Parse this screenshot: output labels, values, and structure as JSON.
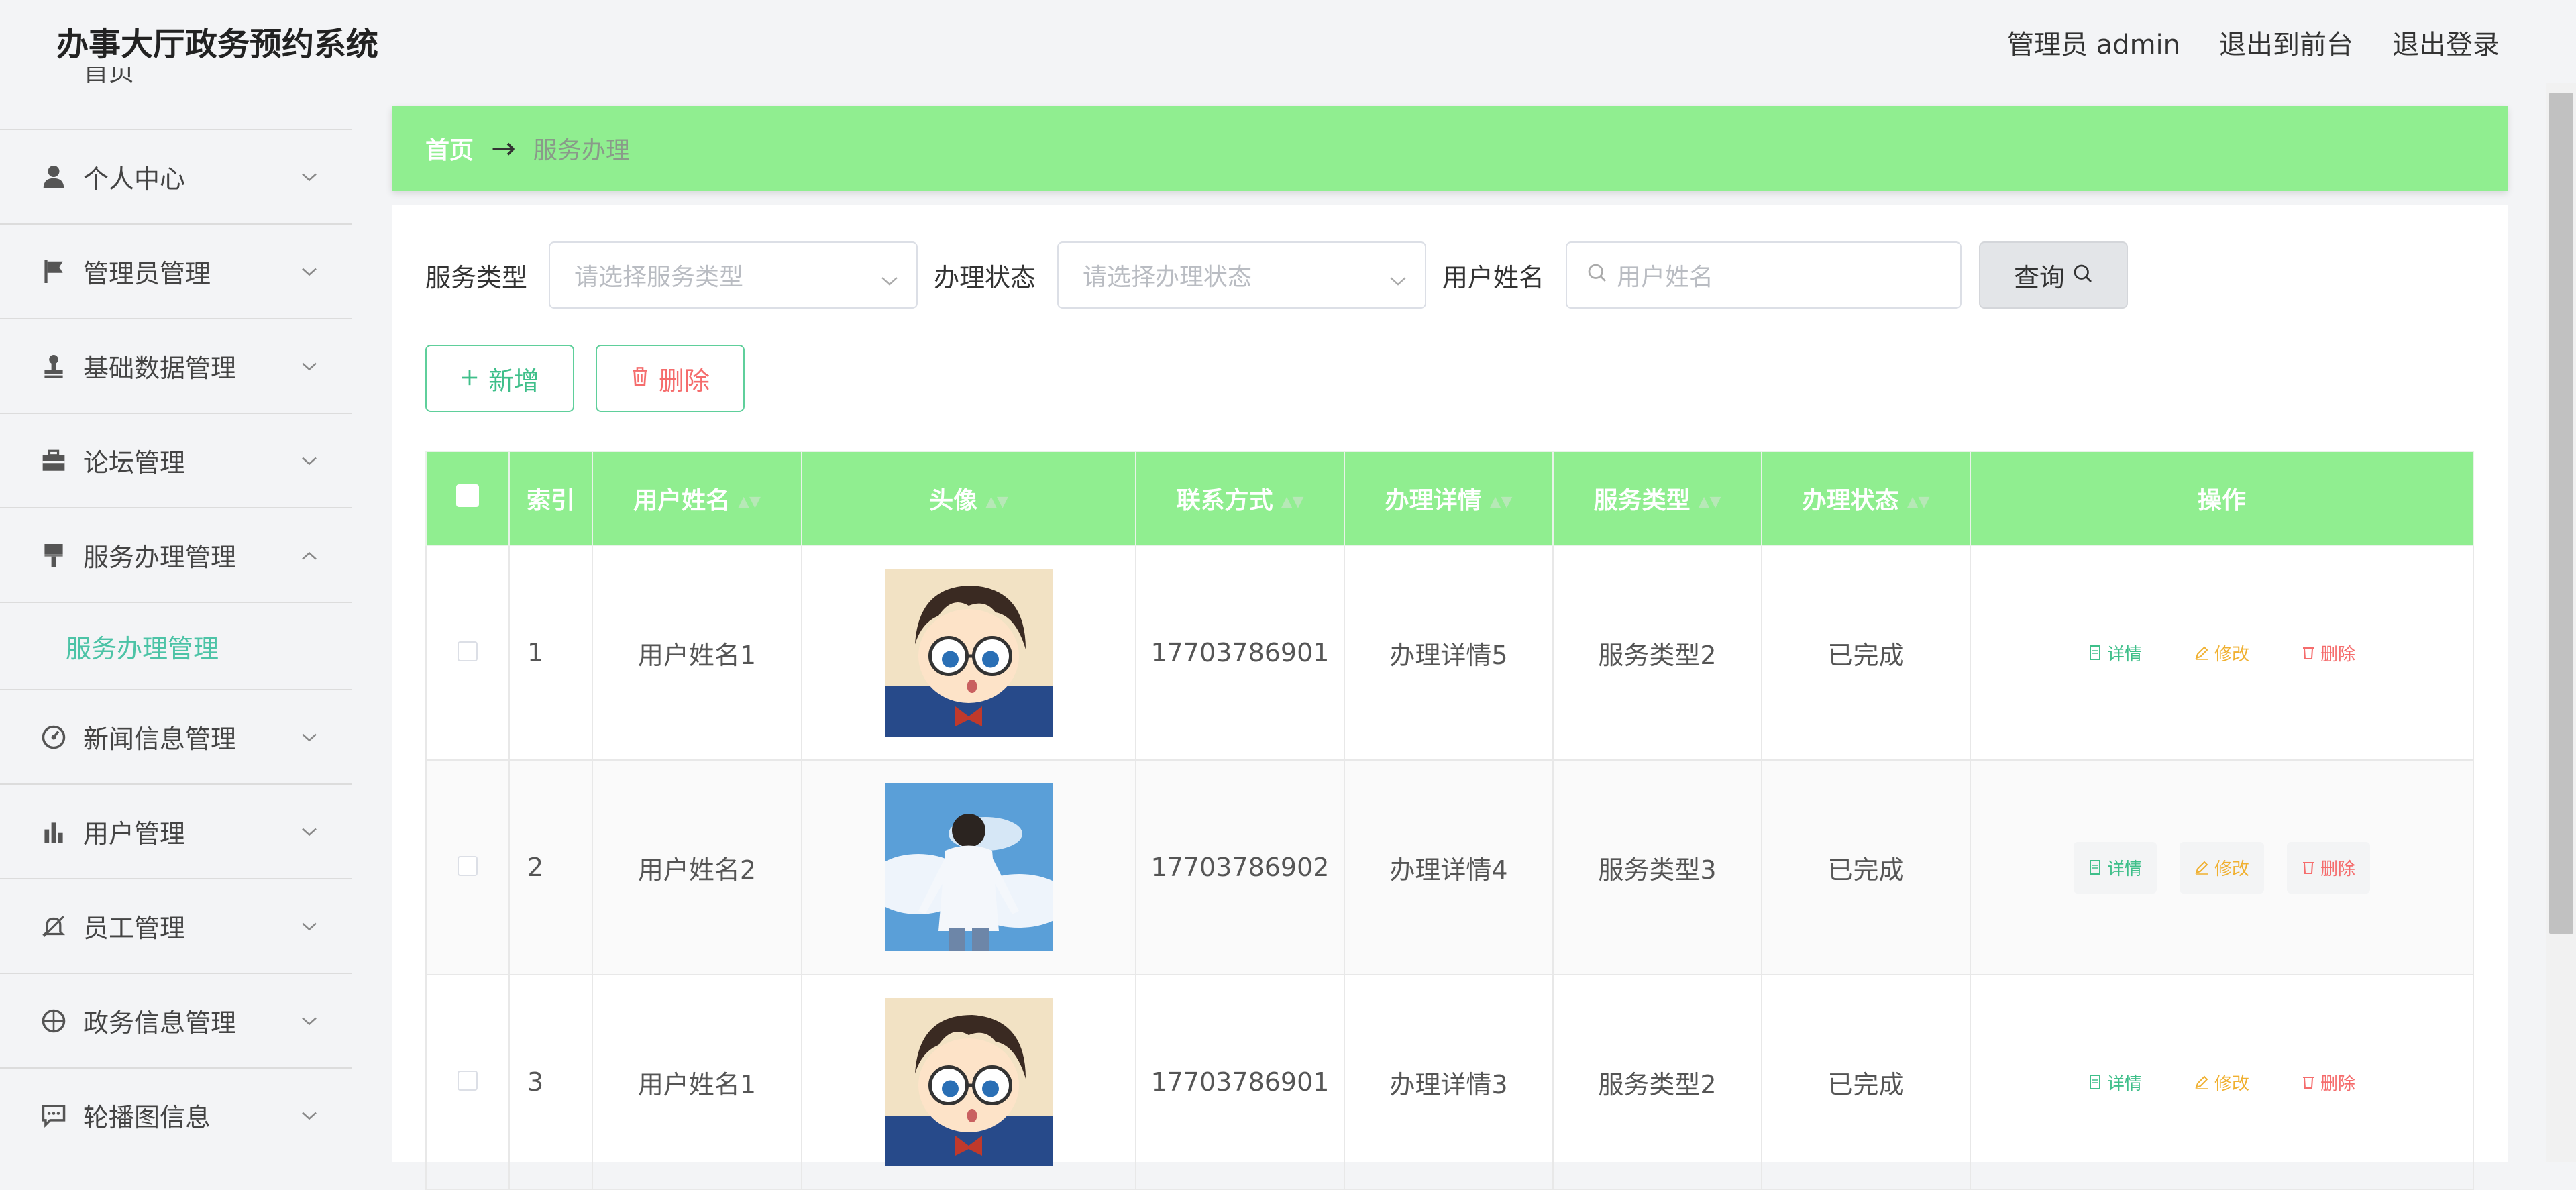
{
  "header": {
    "app_title": "办事大厅政务预约系统",
    "admin_label": "管理员 admin",
    "front_link": "退出到前台",
    "logout_link": "退出登录"
  },
  "sidebar": {
    "partial_item": "首页",
    "items": [
      {
        "label": "个人中心",
        "icon": "person-icon"
      },
      {
        "label": "管理员管理",
        "icon": "flag-icon"
      },
      {
        "label": "基础数据管理",
        "icon": "stamp-icon"
      },
      {
        "label": "论坛管理",
        "icon": "briefcase-icon"
      },
      {
        "label": "服务办理管理",
        "icon": "brush-icon",
        "expanded": true
      },
      {
        "label": "新闻信息管理",
        "icon": "gauge-icon"
      },
      {
        "label": "用户管理",
        "icon": "bar-chart-icon"
      },
      {
        "label": "员工管理",
        "icon": "bell-off-icon"
      },
      {
        "label": "政务信息管理",
        "icon": "compass-icon"
      },
      {
        "label": "轮播图信息",
        "icon": "chat-icon"
      }
    ],
    "sub_item": "服务办理管理",
    "accent_color": "#4cc3a6"
  },
  "breadcrumb": {
    "home": "首页",
    "arrow": "→",
    "current": "服务办理"
  },
  "search": {
    "service_type_label": "服务类型",
    "service_type_placeholder": "请选择服务类型",
    "status_label": "办理状态",
    "status_placeholder": "请选择办理状态",
    "username_label": "用户姓名",
    "username_placeholder": "用户姓名",
    "query_button": "查询"
  },
  "actions": {
    "add_button": "新增",
    "delete_button": "删除"
  },
  "table": {
    "header_color": "#90ee90",
    "columns": [
      "索引",
      "用户姓名",
      "头像",
      "联系方式",
      "办理详情",
      "服务类型",
      "办理状态",
      "操作"
    ],
    "rows": [
      {
        "index": "1",
        "username": "用户姓名1",
        "avatar": "avatar-conan",
        "phone": "17703786901",
        "detail": "办理详情5",
        "service_type": "服务类型2",
        "status": "已完成"
      },
      {
        "index": "2",
        "username": "用户姓名2",
        "avatar": "avatar-sky-boy",
        "phone": "17703786902",
        "detail": "办理详情4",
        "service_type": "服务类型3",
        "status": "已完成"
      },
      {
        "index": "3",
        "username": "用户姓名1",
        "avatar": "avatar-conan",
        "phone": "17703786901",
        "detail": "办理详情3",
        "service_type": "服务类型2",
        "status": "已完成"
      }
    ],
    "row_actions": {
      "detail": "详情",
      "edit": "修改",
      "remove": "删除"
    }
  }
}
